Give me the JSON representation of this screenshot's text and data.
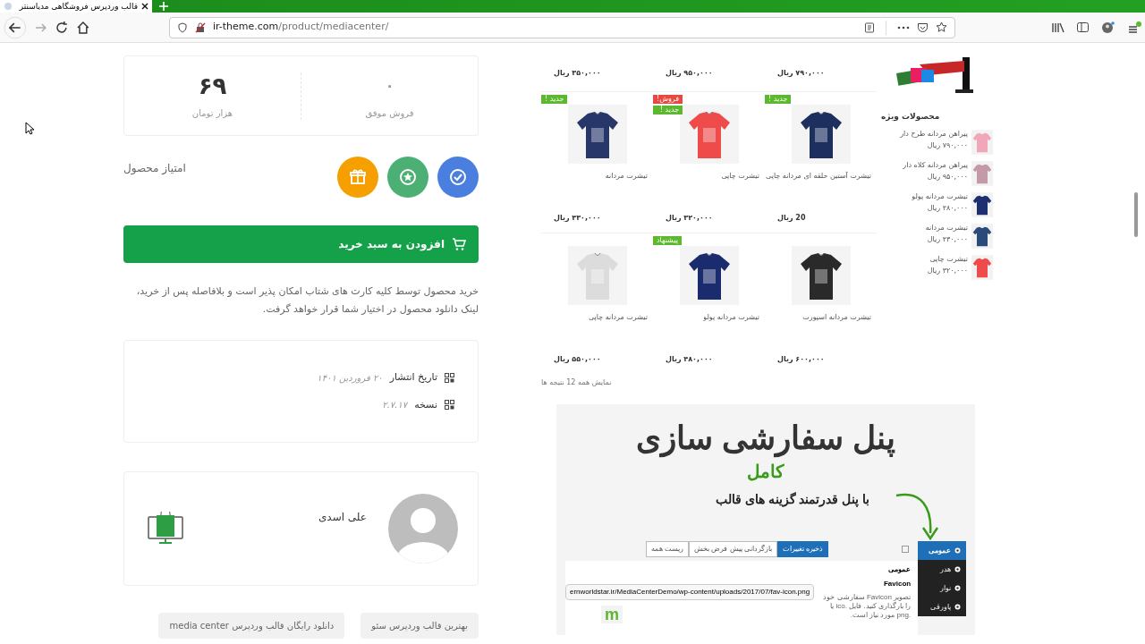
{
  "browser": {
    "tab_title": "قالب وردپرس فروشگاهی مدیاسنتر",
    "url_host": "ir-theme.com",
    "url_path": "/product/mediacenter/"
  },
  "stats": [
    {
      "value": "۰",
      "label": "فروش موفق"
    },
    {
      "value": "۶۹",
      "label": "هزار تومان"
    }
  ],
  "rating": {
    "label": "امتیاز محصول",
    "badges": [
      {
        "kind": "check",
        "color": "#4a7fe0"
      },
      {
        "kind": "star",
        "color": "#4caf73"
      },
      {
        "kind": "gift",
        "color": "#f5a000"
      }
    ]
  },
  "cart_button": "افزودن به سبد خرید",
  "note": "خرید محصول توسط کلیه کارت های شتاب امکان پذیر است و بلافاصله پس از خرید، لینک دانلود محصول در اختیار شما قرار خواهد گرفت.",
  "meta": [
    {
      "label": "تاریخ انتشار",
      "value": "۲۰ فروردین ۱۴۰۱"
    },
    {
      "label": "نسخه",
      "value": "۲.۷.۱۷"
    }
  ],
  "author": {
    "name": "علی اسدی"
  },
  "tags": [
    "بهترین قالب وردپرس سئو",
    "دانلود رایگان قالب وردپرس media center"
  ],
  "showcase": {
    "top_prices": [
      "۷۹۰,۰۰۰ ریال",
      "۹۵۰,۰۰۰ ریال",
      "۳۵۰,۰۰۰ ریال"
    ],
    "products": [
      {
        "name": "تیشرت آستین حلقه ای مردانه چاپی",
        "price": "20 ریال",
        "badges": [
          {
            "text": "جدید !",
            "color": "#5cb82e"
          }
        ]
      },
      {
        "name": "تیشرت چاپی",
        "price": "۳۲۰,۰۰۰ ریال",
        "badges": [
          {
            "text": "فروش!",
            "color": "#e8483f"
          },
          {
            "text": "جدید !",
            "color": "#5cb82e"
          }
        ]
      },
      {
        "name": "تیشرت مردانه",
        "price": "۴۳۰,۰۰۰ ریال",
        "badges": [
          {
            "text": "جدید !",
            "color": "#5cb82e"
          }
        ]
      },
      {
        "name": "تیشرت مردانه اسپورت",
        "price": "۶۰۰,۰۰۰ ریال"
      },
      {
        "name": "تیشرت مردانه پولو",
        "price": "۴۸۰,۰۰۰ ریال",
        "badges": [
          {
            "text": "پیشنهاد",
            "color": "#5cb82e"
          }
        ]
      },
      {
        "name": "تیشرت مردانه چاپی",
        "price": "۵۵۰,۰۰۰ ریال"
      }
    ],
    "special_title": "محصولات ویژه",
    "special": [
      {
        "name": "پیراهن مردانه طرح دار",
        "price": "۷۹۰,۰۰۰ ریال"
      },
      {
        "name": "پیراهن مردانه کلاه دار",
        "price": "۹۵۰,۰۰۰ ریال"
      },
      {
        "name": "تیشرت مردانه پولو",
        "price": "۴۸۰,۰۰۰ ریال"
      },
      {
        "name": "تیشرت مردانه",
        "price": "۴۳۰,۰۰۰ ریال"
      },
      {
        "name": "تیشرت چاپی",
        "price": "۳۲۰,۰۰۰ ریال"
      }
    ],
    "result_count": "نمایش همه 12 نتیجه ها"
  },
  "customizer": {
    "title": "پنل سفارشی سازی",
    "highlight": "کامل",
    "tagline": "با پنل قدرتمند گزینه های قالب",
    "buttons": [
      {
        "label": "ذخیره تغییرات",
        "kind": "primary"
      },
      {
        "label": "بازگردانی پیش فرض بخش",
        "kind": "plain"
      },
      {
        "label": "ریست همه",
        "kind": "plain"
      }
    ],
    "menu": [
      {
        "label": "عمومی",
        "selected": true
      },
      {
        "label": "هدر",
        "selected": false
      },
      {
        "label": "نوار",
        "selected": false
      },
      {
        "label": "پاورقی",
        "selected": false
      }
    ],
    "section_title": "عمومی",
    "field_label": "Favicon",
    "field_desc": "تصویر Favicon سفارشی خود را بارگذاری کنید. فایل .ico یا .png مورد نیاز است.",
    "url_value": "ernworldstar.ir/MediaCenterDemo/wp-content/uploads/2017/07/fav-icon.png",
    "logo_letter": "m"
  }
}
